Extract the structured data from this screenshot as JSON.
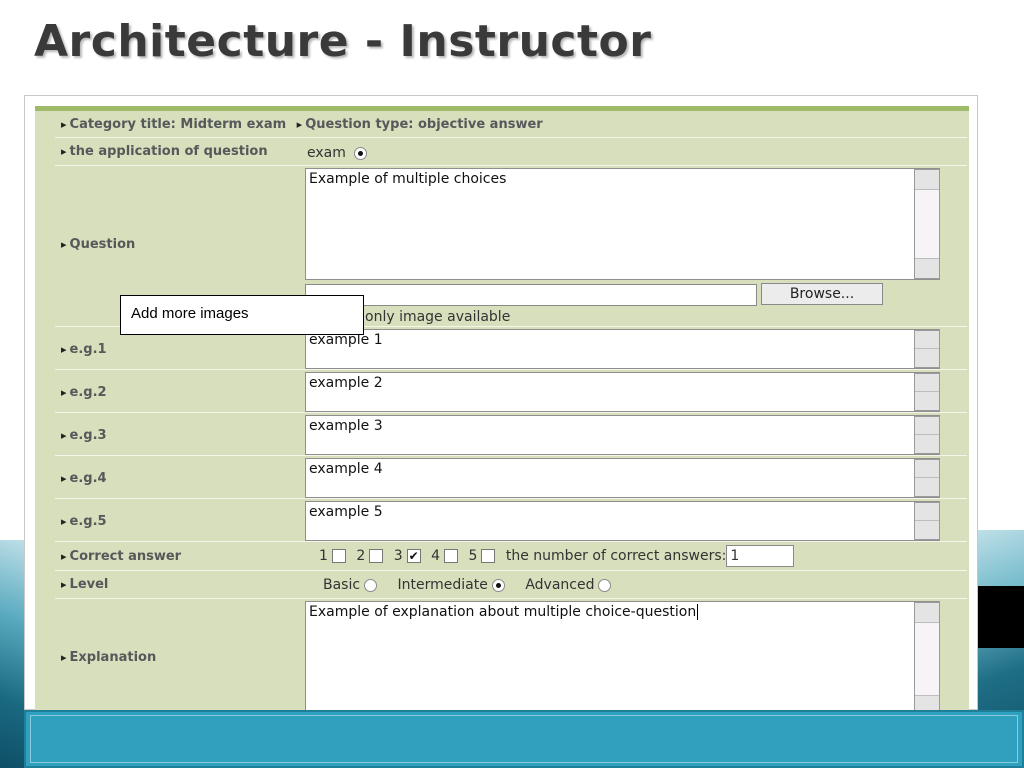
{
  "slide": {
    "title": "Architecture - Instructor"
  },
  "header": {
    "category": "Category title: Midterm exam",
    "question_type": "Question type: objective answer"
  },
  "application": {
    "label": "the application of question",
    "option": "exam"
  },
  "question": {
    "label": "Question",
    "text": "Example of multiple choices",
    "browse_label": "Browse...",
    "note": "only image available"
  },
  "examples": [
    {
      "label": "e.g.1",
      "value": "example 1"
    },
    {
      "label": "e.g.2",
      "value": "example 2"
    },
    {
      "label": "e.g.3",
      "value": "example 3"
    },
    {
      "label": "e.g.4",
      "value": "example 4"
    },
    {
      "label": "e.g.5",
      "value": "example 5"
    }
  ],
  "correct_answer": {
    "label": "Correct answer",
    "options": [
      "1",
      "2",
      "3",
      "4",
      "5"
    ],
    "checked": [
      "3"
    ],
    "count_label": "the number of correct answers:",
    "count_value": "1",
    "check_mark": "✔"
  },
  "level": {
    "label": "Level",
    "options": [
      "Basic",
      "Intermediate",
      "Advanced"
    ],
    "selected": "Intermediate"
  },
  "explanation": {
    "label": "Explanation",
    "text": "Example of explanation about multiple choice-question"
  },
  "callout": {
    "text": "Add more images"
  },
  "colors": {
    "panel_bg": "#d7dfbd",
    "panel_top": "#9fbb6a",
    "bottom_bar": "#2fa0bd"
  }
}
